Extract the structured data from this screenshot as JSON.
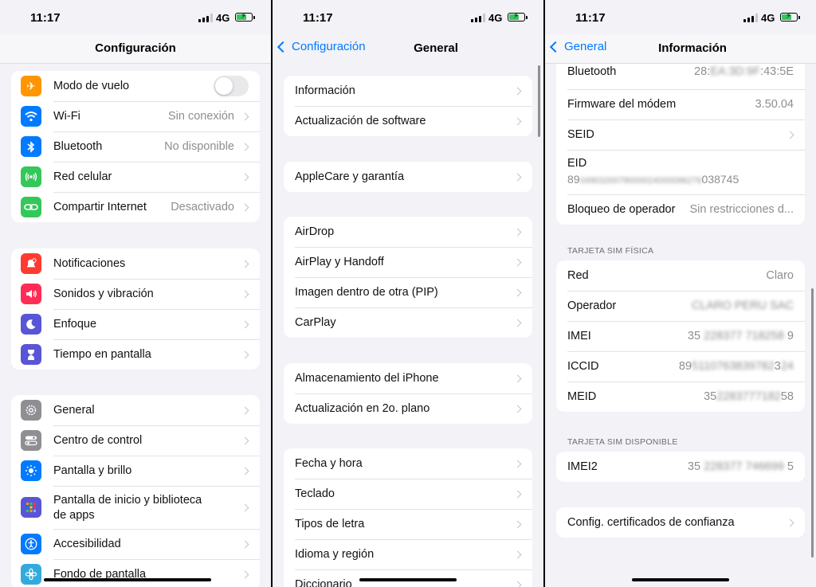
{
  "status_time": "11:17",
  "network": "4G",
  "screen1": {
    "title": "Configuración",
    "group1": [
      {
        "icon": "airplane-icon",
        "label": "Modo de vuelo",
        "value": "",
        "color": "#ff9500"
      },
      {
        "icon": "wifi-icon",
        "label": "Wi-Fi",
        "value": "Sin conexión",
        "color": "#007aff"
      },
      {
        "icon": "bluetooth-icon",
        "label": "Bluetooth",
        "value": "No disponible",
        "color": "#007aff"
      },
      {
        "icon": "cellular-icon",
        "label": "Red celular",
        "value": "",
        "color": "#34c759"
      },
      {
        "icon": "hotspot-icon",
        "label": "Compartir Internet",
        "value": "Desactivado",
        "color": "#34c759"
      }
    ],
    "group2": [
      {
        "icon": "notifications-icon",
        "label": "Notificaciones",
        "color": "#ff3b30"
      },
      {
        "icon": "sounds-icon",
        "label": "Sonidos y vibración",
        "color": "#ff2d55"
      },
      {
        "icon": "focus-icon",
        "label": "Enfoque",
        "color": "#5856d6"
      },
      {
        "icon": "screen-time-icon",
        "label": "Tiempo en pantalla",
        "color": "#5856d6"
      }
    ],
    "group3": [
      {
        "icon": "gear-icon",
        "label": "General",
        "color": "#8e8e93"
      },
      {
        "icon": "control-center-icon",
        "label": "Centro de control",
        "color": "#8e8e93"
      },
      {
        "icon": "brightness-icon",
        "label": "Pantalla y brillo",
        "color": "#007aff"
      },
      {
        "icon": "home-screen-icon",
        "label_line1": "Pantalla de inicio y biblioteca",
        "label_line2": "de apps",
        "color": "#5856d6"
      },
      {
        "icon": "accessibility-icon",
        "label": "Accesibilidad",
        "color": "#007aff"
      },
      {
        "icon": "wallpaper-icon",
        "label": "Fondo de pantalla",
        "color": "#34aadc"
      }
    ]
  },
  "screen2": {
    "back": "Configuración",
    "title": "General",
    "group1": [
      "Información",
      "Actualización de software"
    ],
    "group2": [
      "AppleCare y garantía"
    ],
    "group3": [
      "AirDrop",
      "AirPlay y Handoff",
      "Imagen dentro de otra (PIP)",
      "CarPlay"
    ],
    "group4": [
      "Almacenamiento del iPhone",
      "Actualización en 2o. plano"
    ],
    "group5": [
      "Fecha y hora",
      "Teclado",
      "Tipos de letra",
      "Idioma y región",
      "Diccionario"
    ]
  },
  "screen3": {
    "back": "General",
    "title": "Información",
    "group1": {
      "bluetooth_label": "Bluetooth",
      "bluetooth_prefix": "28:",
      "bluetooth_blur": "EA:3D:9F",
      "bluetooth_suffix": ":43:5E",
      "firmware_label": "Firmware del módem",
      "firmware_value": "3.50.04",
      "seid_label": "SEID",
      "eid_label": "EID",
      "eid_prefix": "89",
      "eid_blur": "0490320078000024000096276",
      "eid_suffix": "038745",
      "lock_label": "Bloqueo de operador",
      "lock_value": "Sin restricciones d..."
    },
    "sim_header": "TARJETA SIM FÍSICA",
    "sim": {
      "red_label": "Red",
      "red_value": "Claro",
      "operator_label": "Operador",
      "operator_blur": "CLARO PERU SAC",
      "imei_label": "IMEI",
      "imei_prefix": "35",
      "imei_blur": "228377 718258",
      "imei_suffix": "9",
      "iccid_label": "ICCID",
      "iccid_prefix": "89",
      "iccid_blur": "5110763839782",
      "iccid_suffix": "3",
      "iccid_tail": "24",
      "meid_label": "MEID",
      "meid_prefix": "35",
      "meid_blur": "2283777182",
      "meid_suffix": "58"
    },
    "sim2_header": "TARJETA SIM DISPONIBLE",
    "sim2": {
      "imei2_label": "IMEI2",
      "imei2_prefix": "35",
      "imei2_blur": "228377 746699",
      "imei2_suffix": "5"
    },
    "certs_label": "Config. certificados de confianza"
  }
}
